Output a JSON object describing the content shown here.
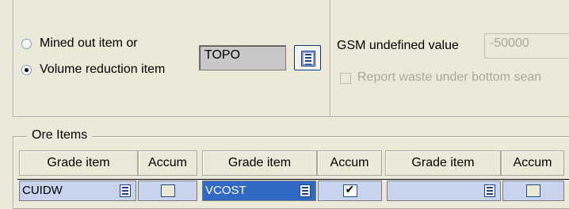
{
  "radio_group": {
    "option1_label": "Mined out item or",
    "option2_label": "Volume reduction item",
    "selected": "Volume reduction item"
  },
  "item_field": {
    "value": "TOPO"
  },
  "gsm": {
    "label": "GSM undefined value",
    "value": "-50000",
    "report_waste_label": "Report waste under bottom sean"
  },
  "ore_items": {
    "title": "Ore Items",
    "columns": [
      "Grade item",
      "Accum",
      "Grade item",
      "Accum",
      "Grade item",
      "Accum"
    ],
    "row": {
      "grade1": "CUIDW",
      "accum1": false,
      "grade2": "VCOST",
      "accum2": true,
      "grade3": "",
      "accum3": false
    }
  },
  "icons": {
    "list": "list-icon"
  },
  "colors": {
    "selected_cell": "#316ac5",
    "row_bg": "#c8d4ee",
    "window_bg": "#ece9d8"
  }
}
